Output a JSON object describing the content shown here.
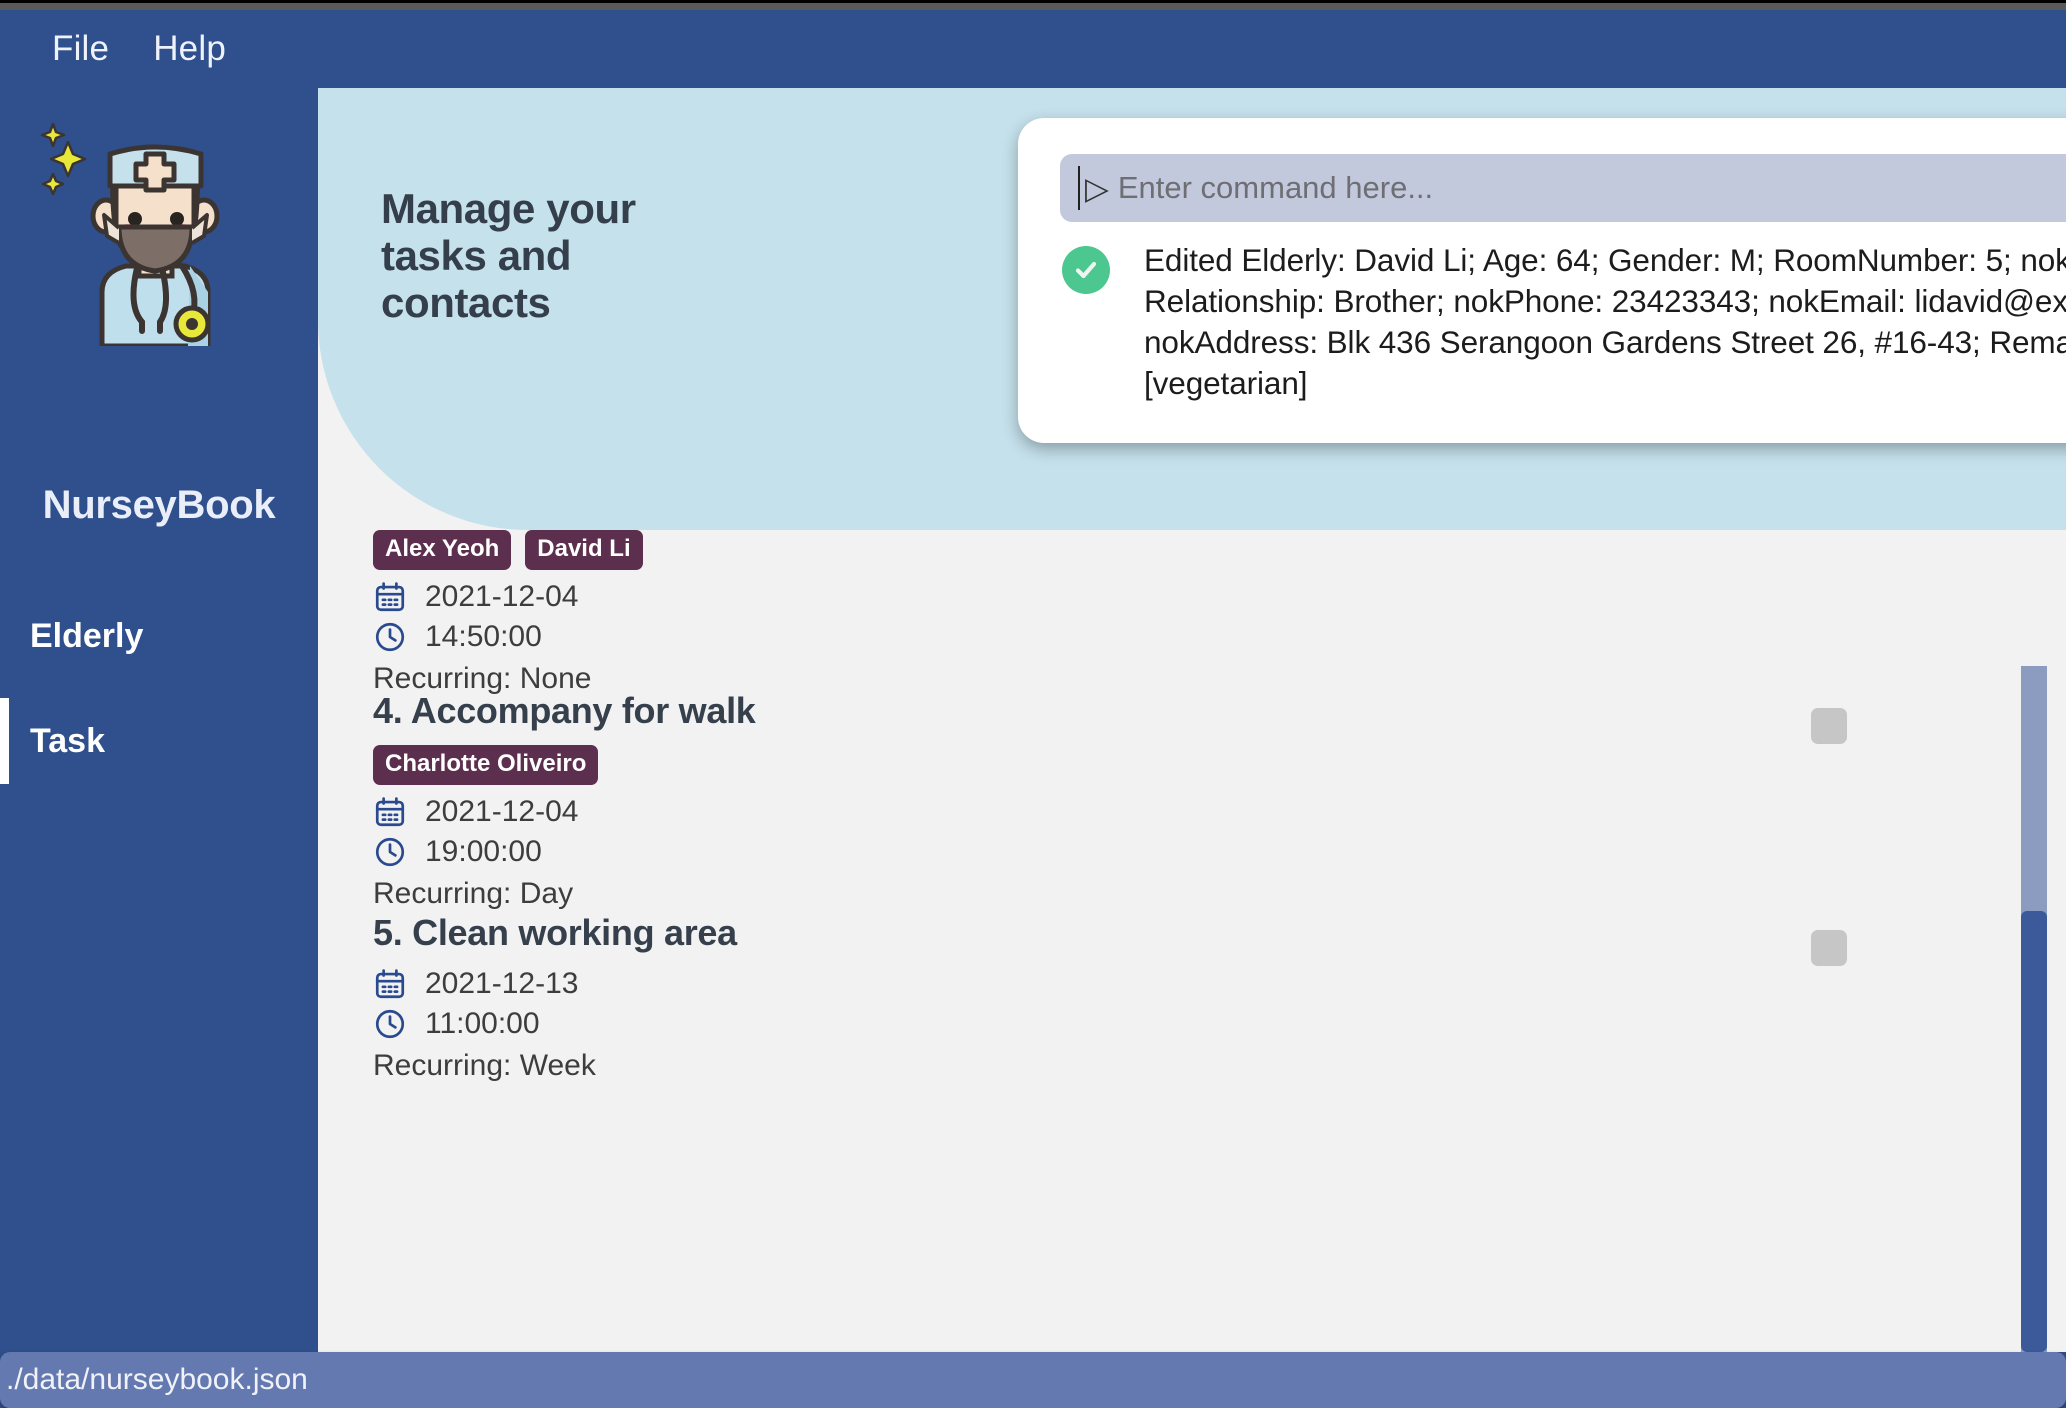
{
  "window": {
    "menu": [
      {
        "label": "File",
        "name": "menu-file"
      },
      {
        "label": "Help",
        "name": "menu-help"
      }
    ]
  },
  "sidebar": {
    "brand": "NurseyBook",
    "logo_icon": "nurse-avatar-icon",
    "items": [
      {
        "label": "Elderly",
        "active": false
      },
      {
        "label": "Task",
        "active": true
      }
    ]
  },
  "hero": {
    "title": "Manage your tasks and contacts"
  },
  "command": {
    "prompt_glyph": "▷",
    "placeholder": "Enter command here...",
    "value": "",
    "result_status_icon": "check-circle-icon",
    "result_text": "Edited Elderly: David Li; Age: 64; Gender: M; RoomNumber: 5; nokName: Rong Hao; Relationship: Brother; nokPhone: 23423343; nokEmail: lidavid@example.com; nokAddress: Blk 436 Serangoon Gardens Street 26, #16-43; Remark: ; Tags: [vegetarian]"
  },
  "task_list": {
    "tasks": [
      {
        "title": "",
        "tags": [
          "Alex Yeoh",
          "David Li"
        ],
        "date": "2021-12-04",
        "time": "14:50:00",
        "recurring": "Recurring: None",
        "has_checkbox": false
      },
      {
        "title": "4. Accompany for walk",
        "tags": [
          "Charlotte Oliveiro"
        ],
        "date": "2021-12-04",
        "time": "19:00:00",
        "recurring": "Recurring: Day",
        "has_checkbox": true
      },
      {
        "title": "5. Clean working area",
        "tags": [],
        "date": "2021-12-13",
        "time": "11:00:00",
        "recurring": "Recurring: Week",
        "has_checkbox": true
      }
    ],
    "date_icon": "calendar-icon",
    "time_icon": "clock-icon"
  },
  "statusbar": {
    "path": "./data/nurseybook.json"
  },
  "colors": {
    "primary": "#2f4f8d",
    "hero": "#c5e1ec",
    "tag": "#5d2f4e",
    "success": "#4cc78f",
    "statusbar": "#6479b0",
    "scrollbar_thumb": "#3c5a9a"
  }
}
